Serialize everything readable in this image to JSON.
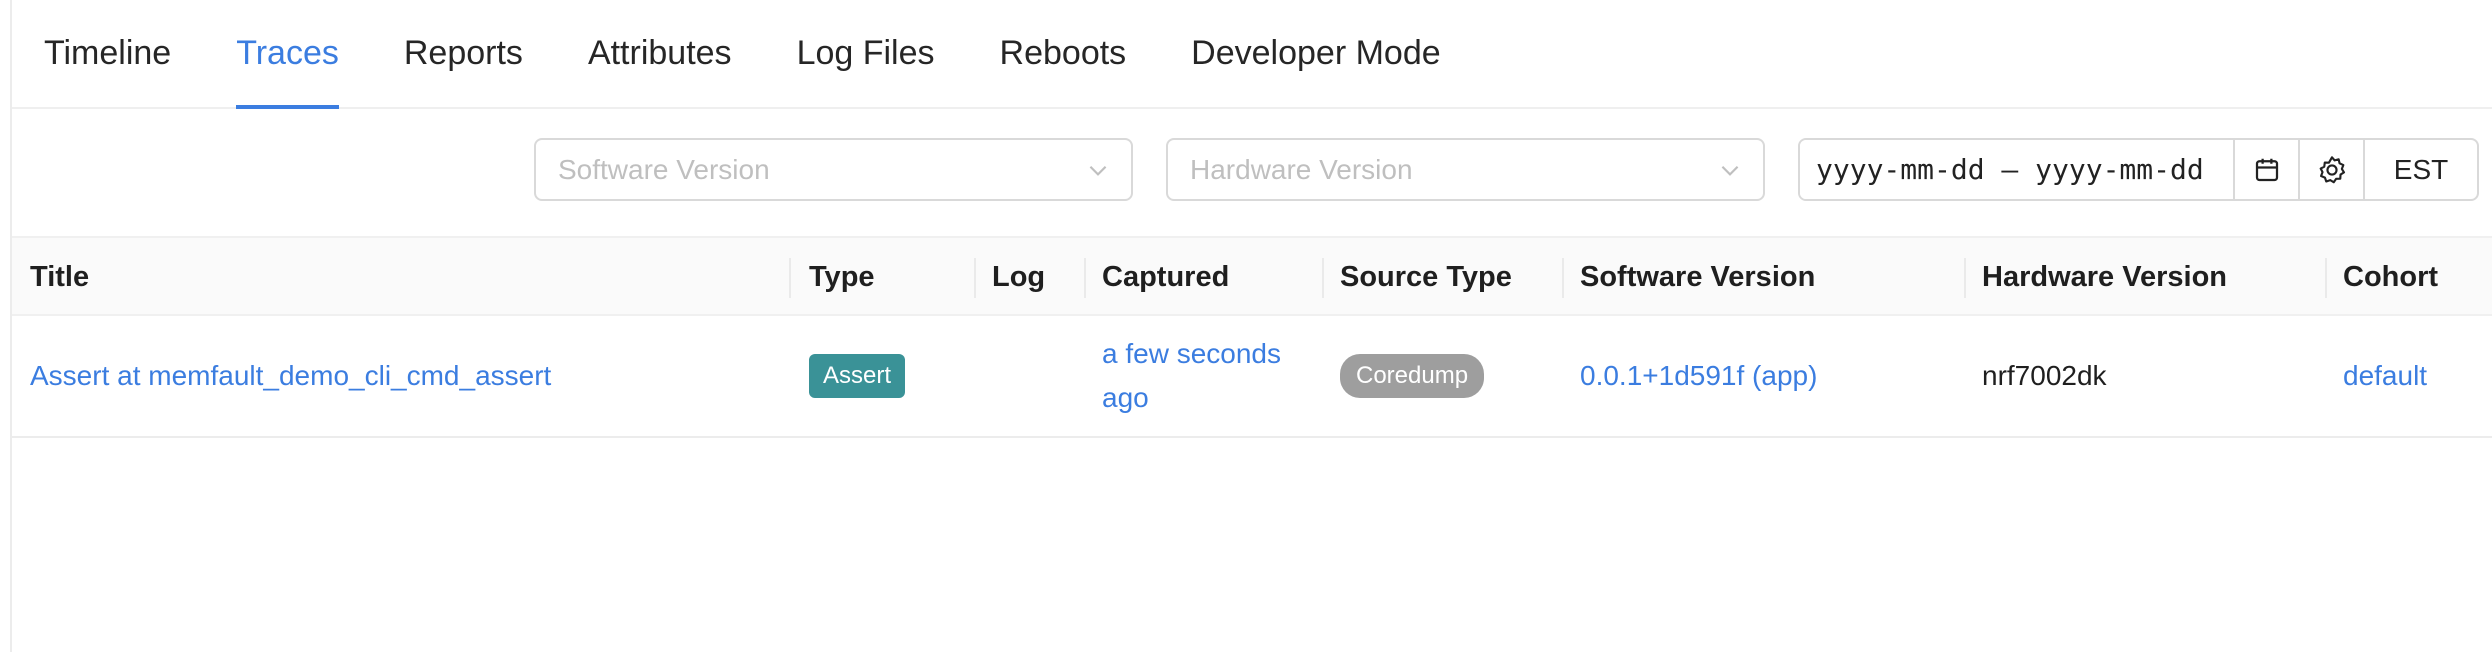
{
  "tabs": [
    {
      "label": "Timeline"
    },
    {
      "label": "Traces"
    },
    {
      "label": "Reports"
    },
    {
      "label": "Attributes"
    },
    {
      "label": "Log Files"
    },
    {
      "label": "Reboots"
    },
    {
      "label": "Developer Mode"
    }
  ],
  "active_tab": "Traces",
  "filters": {
    "software_version_placeholder": "Software Version",
    "hardware_version_placeholder": "Hardware Version",
    "date_range_value": "yyyy-mm-dd – yyyy-mm-dd",
    "timezone": "EST"
  },
  "table": {
    "columns": [
      "Title",
      "Type",
      "Log",
      "Captured",
      "Source Type",
      "Software Version",
      "Hardware Version",
      "Cohort"
    ],
    "rows": [
      {
        "title": "Assert at memfault_demo_cli_cmd_assert",
        "type": "Assert",
        "log": "",
        "captured": "a few seconds ago",
        "source_type": "Coredump",
        "software_version": "0.0.1+1d591f (app)",
        "hardware_version": "nrf7002dk",
        "cohort": "default"
      }
    ]
  },
  "colors": {
    "accent": "#3b7de0",
    "assert_badge": "#3a9297",
    "coredump_badge": "#9e9e9e"
  },
  "icons": [
    "chevron-down-icon",
    "calendar-icon",
    "gear-icon"
  ]
}
